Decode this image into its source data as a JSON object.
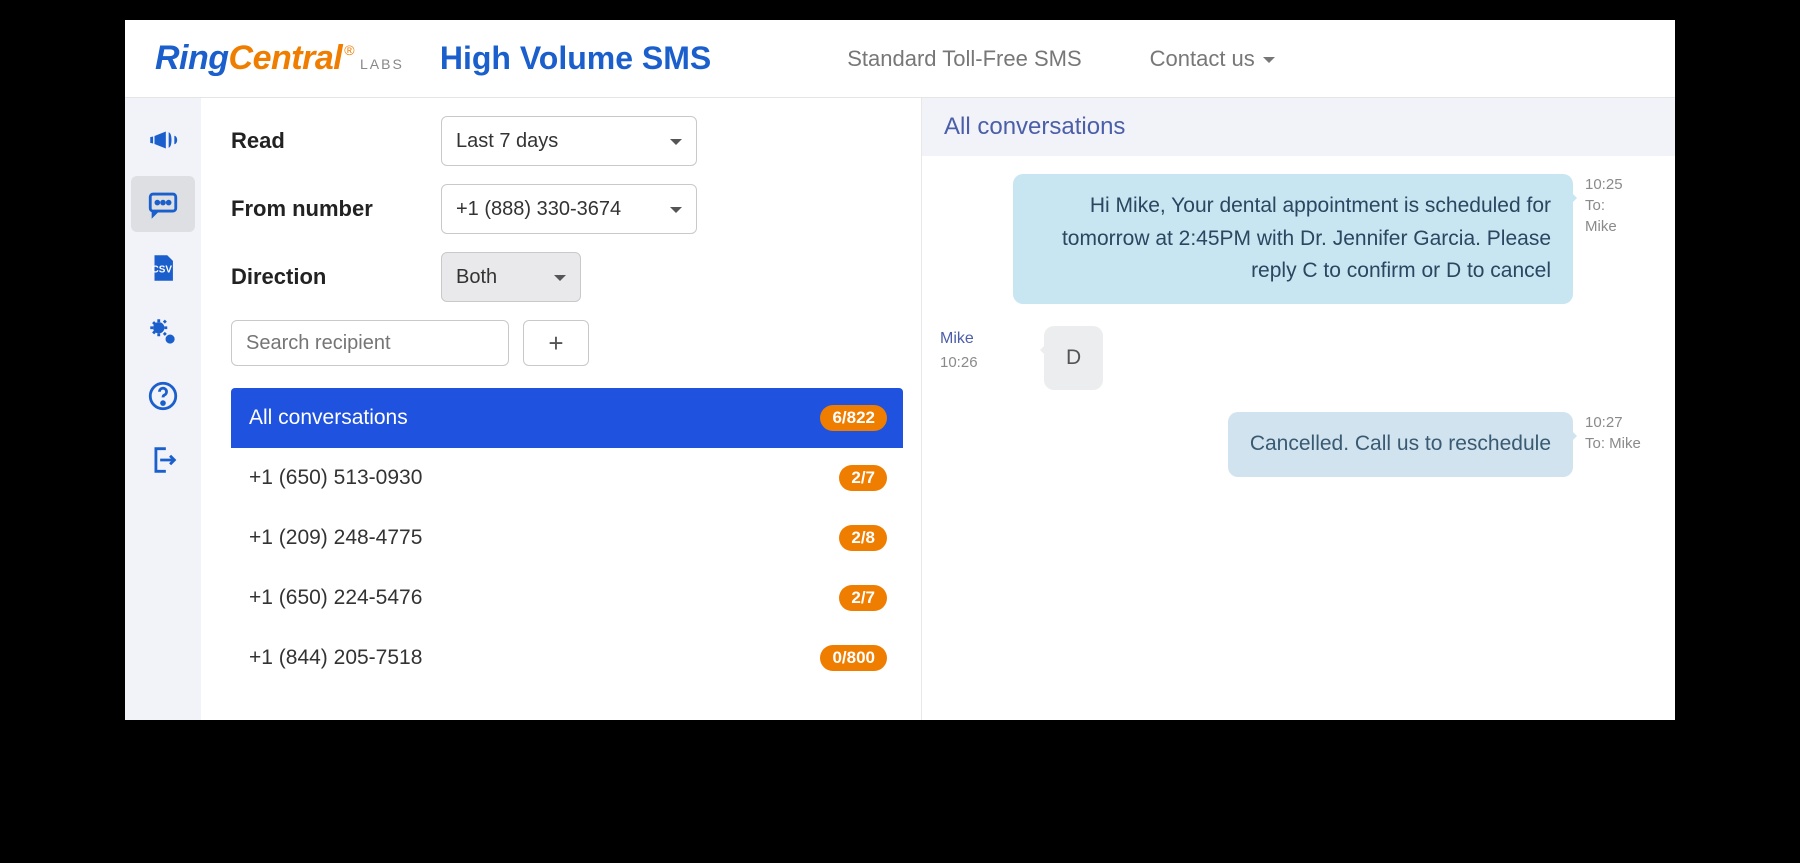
{
  "brand": {
    "ring": "Ring",
    "central": "Central",
    "reg": "®",
    "labs": "LABS"
  },
  "nav": {
    "title": "High Volume SMS",
    "link_standard": "Standard Toll-Free SMS",
    "link_contact": "Contact us"
  },
  "filters": {
    "read_label": "Read",
    "read_value": "Last 7 days",
    "from_label": "From number",
    "from_value": "+1 (888) 330-3674",
    "direction_label": "Direction",
    "direction_value": "Both",
    "search_placeholder": "Search recipient",
    "plus_label": "+"
  },
  "conversations": {
    "header_label": "All conversations",
    "header_badge": "6/822",
    "items": [
      {
        "label": "+1 (650) 513-0930",
        "badge": "2/7"
      },
      {
        "label": "+1 (209) 248-4775",
        "badge": "2/8"
      },
      {
        "label": "+1 (650) 224-5476",
        "badge": "2/7"
      },
      {
        "label": "+1 (844) 205-7518",
        "badge": "0/800"
      }
    ]
  },
  "chat": {
    "header": "All conversations",
    "messages": [
      {
        "dir": "out",
        "style": "out1",
        "text": "Hi Mike, Your dental appointment is scheduled for tomorrow at 2:45PM with Dr. Jennifer Garcia. Please reply C to confirm or D to cancel",
        "meta1": "10:25",
        "meta2": "To:",
        "meta3": "Mike"
      },
      {
        "dir": "in",
        "style": "in1",
        "text": "D",
        "meta1": "Mike",
        "meta2": "10:26"
      },
      {
        "dir": "out",
        "style": "out2",
        "text": "Cancelled. Call us to reschedule",
        "meta1": "10:27",
        "meta2": "To: Mike"
      }
    ]
  }
}
